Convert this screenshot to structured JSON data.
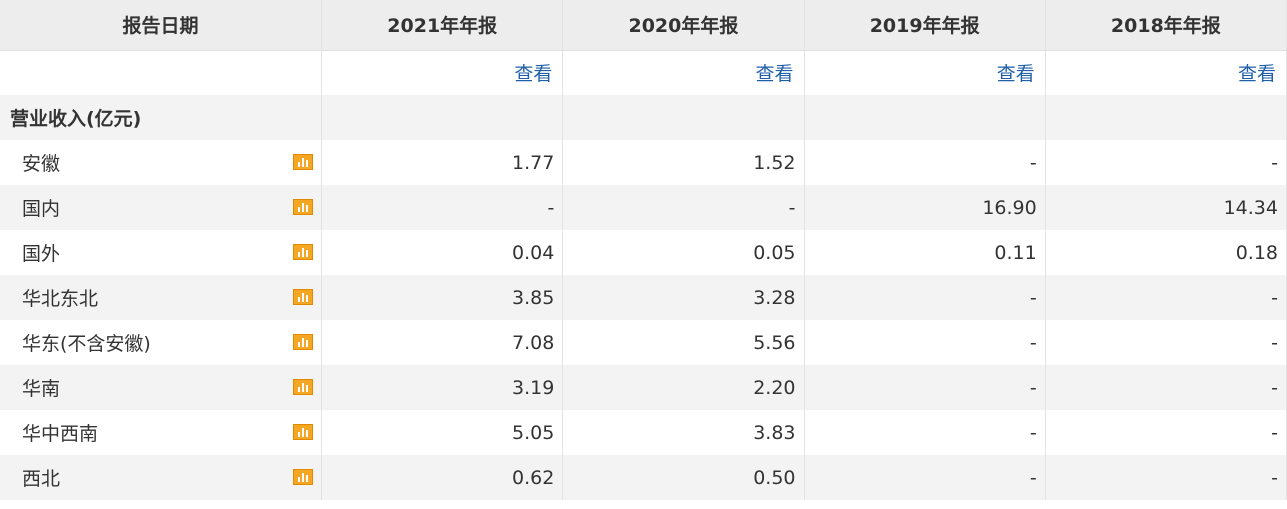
{
  "header": {
    "label_col": "报告日期",
    "years": [
      "2021年年报",
      "2020年年报",
      "2019年年报",
      "2018年年报"
    ]
  },
  "view_link": "查看",
  "section_title": "营业收入(亿元)",
  "rows": [
    {
      "label": "安徽",
      "values": [
        "1.77",
        "1.52",
        "-",
        "-"
      ]
    },
    {
      "label": "国内",
      "values": [
        "-",
        "-",
        "16.90",
        "14.34"
      ]
    },
    {
      "label": "国外",
      "values": [
        "0.04",
        "0.05",
        "0.11",
        "0.18"
      ]
    },
    {
      "label": "华北东北",
      "values": [
        "3.85",
        "3.28",
        "-",
        "-"
      ]
    },
    {
      "label": "华东(不含安徽)",
      "values": [
        "7.08",
        "5.56",
        "-",
        "-"
      ]
    },
    {
      "label": "华南",
      "values": [
        "3.19",
        "2.20",
        "-",
        "-"
      ]
    },
    {
      "label": "华中西南",
      "values": [
        "5.05",
        "3.83",
        "-",
        "-"
      ]
    },
    {
      "label": "西北",
      "values": [
        "0.62",
        "0.50",
        "-",
        "-"
      ]
    }
  ],
  "icons": {
    "chart": "bar-chart-icon"
  },
  "colors": {
    "link": "#1f5fa8",
    "icon": "#f5a623",
    "header_bg": "#ededed",
    "alt_row_bg": "#f3f3f3"
  }
}
